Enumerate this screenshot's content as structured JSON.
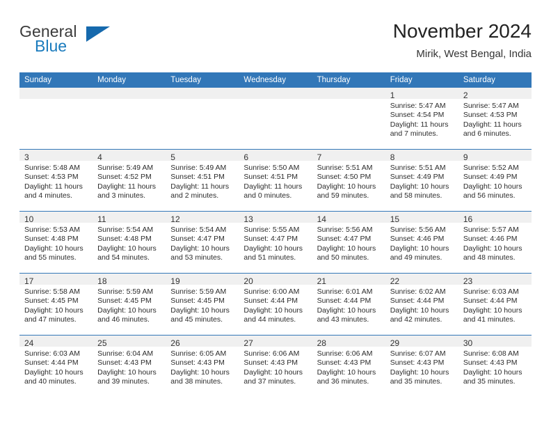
{
  "brand": {
    "name_top": "General",
    "name_bottom": "Blue",
    "accent_color": "#1a7bbd",
    "flag_icon": "triangle-flag-icon"
  },
  "header": {
    "month_title": "November 2024",
    "location": "Mirik, West Bengal, India"
  },
  "calendar": {
    "header_bg": "#3277b8",
    "daynum_bg": "#f0f0f0",
    "weekday_headers": [
      "Sunday",
      "Monday",
      "Tuesday",
      "Wednesday",
      "Thursday",
      "Friday",
      "Saturday"
    ],
    "weeks": [
      [
        {
          "day": "",
          "sunrise": "",
          "sunset": "",
          "daylight": "",
          "blank": true
        },
        {
          "day": "",
          "sunrise": "",
          "sunset": "",
          "daylight": "",
          "blank": true
        },
        {
          "day": "",
          "sunrise": "",
          "sunset": "",
          "daylight": "",
          "blank": true
        },
        {
          "day": "",
          "sunrise": "",
          "sunset": "",
          "daylight": "",
          "blank": true
        },
        {
          "day": "",
          "sunrise": "",
          "sunset": "",
          "daylight": "",
          "blank": true
        },
        {
          "day": "1",
          "sunrise": "Sunrise: 5:47 AM",
          "sunset": "Sunset: 4:54 PM",
          "daylight": "Daylight: 11 hours and 7 minutes.",
          "blank": false
        },
        {
          "day": "2",
          "sunrise": "Sunrise: 5:47 AM",
          "sunset": "Sunset: 4:53 PM",
          "daylight": "Daylight: 11 hours and 6 minutes.",
          "blank": false
        }
      ],
      [
        {
          "day": "3",
          "sunrise": "Sunrise: 5:48 AM",
          "sunset": "Sunset: 4:53 PM",
          "daylight": "Daylight: 11 hours and 4 minutes.",
          "blank": false
        },
        {
          "day": "4",
          "sunrise": "Sunrise: 5:49 AM",
          "sunset": "Sunset: 4:52 PM",
          "daylight": "Daylight: 11 hours and 3 minutes.",
          "blank": false
        },
        {
          "day": "5",
          "sunrise": "Sunrise: 5:49 AM",
          "sunset": "Sunset: 4:51 PM",
          "daylight": "Daylight: 11 hours and 2 minutes.",
          "blank": false
        },
        {
          "day": "6",
          "sunrise": "Sunrise: 5:50 AM",
          "sunset": "Sunset: 4:51 PM",
          "daylight": "Daylight: 11 hours and 0 minutes.",
          "blank": false
        },
        {
          "day": "7",
          "sunrise": "Sunrise: 5:51 AM",
          "sunset": "Sunset: 4:50 PM",
          "daylight": "Daylight: 10 hours and 59 minutes.",
          "blank": false
        },
        {
          "day": "8",
          "sunrise": "Sunrise: 5:51 AM",
          "sunset": "Sunset: 4:49 PM",
          "daylight": "Daylight: 10 hours and 58 minutes.",
          "blank": false
        },
        {
          "day": "9",
          "sunrise": "Sunrise: 5:52 AM",
          "sunset": "Sunset: 4:49 PM",
          "daylight": "Daylight: 10 hours and 56 minutes.",
          "blank": false
        }
      ],
      [
        {
          "day": "10",
          "sunrise": "Sunrise: 5:53 AM",
          "sunset": "Sunset: 4:48 PM",
          "daylight": "Daylight: 10 hours and 55 minutes.",
          "blank": false
        },
        {
          "day": "11",
          "sunrise": "Sunrise: 5:54 AM",
          "sunset": "Sunset: 4:48 PM",
          "daylight": "Daylight: 10 hours and 54 minutes.",
          "blank": false
        },
        {
          "day": "12",
          "sunrise": "Sunrise: 5:54 AM",
          "sunset": "Sunset: 4:47 PM",
          "daylight": "Daylight: 10 hours and 53 minutes.",
          "blank": false
        },
        {
          "day": "13",
          "sunrise": "Sunrise: 5:55 AM",
          "sunset": "Sunset: 4:47 PM",
          "daylight": "Daylight: 10 hours and 51 minutes.",
          "blank": false
        },
        {
          "day": "14",
          "sunrise": "Sunrise: 5:56 AM",
          "sunset": "Sunset: 4:47 PM",
          "daylight": "Daylight: 10 hours and 50 minutes.",
          "blank": false
        },
        {
          "day": "15",
          "sunrise": "Sunrise: 5:56 AM",
          "sunset": "Sunset: 4:46 PM",
          "daylight": "Daylight: 10 hours and 49 minutes.",
          "blank": false
        },
        {
          "day": "16",
          "sunrise": "Sunrise: 5:57 AM",
          "sunset": "Sunset: 4:46 PM",
          "daylight": "Daylight: 10 hours and 48 minutes.",
          "blank": false
        }
      ],
      [
        {
          "day": "17",
          "sunrise": "Sunrise: 5:58 AM",
          "sunset": "Sunset: 4:45 PM",
          "daylight": "Daylight: 10 hours and 47 minutes.",
          "blank": false
        },
        {
          "day": "18",
          "sunrise": "Sunrise: 5:59 AM",
          "sunset": "Sunset: 4:45 PM",
          "daylight": "Daylight: 10 hours and 46 minutes.",
          "blank": false
        },
        {
          "day": "19",
          "sunrise": "Sunrise: 5:59 AM",
          "sunset": "Sunset: 4:45 PM",
          "daylight": "Daylight: 10 hours and 45 minutes.",
          "blank": false
        },
        {
          "day": "20",
          "sunrise": "Sunrise: 6:00 AM",
          "sunset": "Sunset: 4:44 PM",
          "daylight": "Daylight: 10 hours and 44 minutes.",
          "blank": false
        },
        {
          "day": "21",
          "sunrise": "Sunrise: 6:01 AM",
          "sunset": "Sunset: 4:44 PM",
          "daylight": "Daylight: 10 hours and 43 minutes.",
          "blank": false
        },
        {
          "day": "22",
          "sunrise": "Sunrise: 6:02 AM",
          "sunset": "Sunset: 4:44 PM",
          "daylight": "Daylight: 10 hours and 42 minutes.",
          "blank": false
        },
        {
          "day": "23",
          "sunrise": "Sunrise: 6:03 AM",
          "sunset": "Sunset: 4:44 PM",
          "daylight": "Daylight: 10 hours and 41 minutes.",
          "blank": false
        }
      ],
      [
        {
          "day": "24",
          "sunrise": "Sunrise: 6:03 AM",
          "sunset": "Sunset: 4:44 PM",
          "daylight": "Daylight: 10 hours and 40 minutes.",
          "blank": false
        },
        {
          "day": "25",
          "sunrise": "Sunrise: 6:04 AM",
          "sunset": "Sunset: 4:43 PM",
          "daylight": "Daylight: 10 hours and 39 minutes.",
          "blank": false
        },
        {
          "day": "26",
          "sunrise": "Sunrise: 6:05 AM",
          "sunset": "Sunset: 4:43 PM",
          "daylight": "Daylight: 10 hours and 38 minutes.",
          "blank": false
        },
        {
          "day": "27",
          "sunrise": "Sunrise: 6:06 AM",
          "sunset": "Sunset: 4:43 PM",
          "daylight": "Daylight: 10 hours and 37 minutes.",
          "blank": false
        },
        {
          "day": "28",
          "sunrise": "Sunrise: 6:06 AM",
          "sunset": "Sunset: 4:43 PM",
          "daylight": "Daylight: 10 hours and 36 minutes.",
          "blank": false
        },
        {
          "day": "29",
          "sunrise": "Sunrise: 6:07 AM",
          "sunset": "Sunset: 4:43 PM",
          "daylight": "Daylight: 10 hours and 35 minutes.",
          "blank": false
        },
        {
          "day": "30",
          "sunrise": "Sunrise: 6:08 AM",
          "sunset": "Sunset: 4:43 PM",
          "daylight": "Daylight: 10 hours and 35 minutes.",
          "blank": false
        }
      ]
    ]
  }
}
